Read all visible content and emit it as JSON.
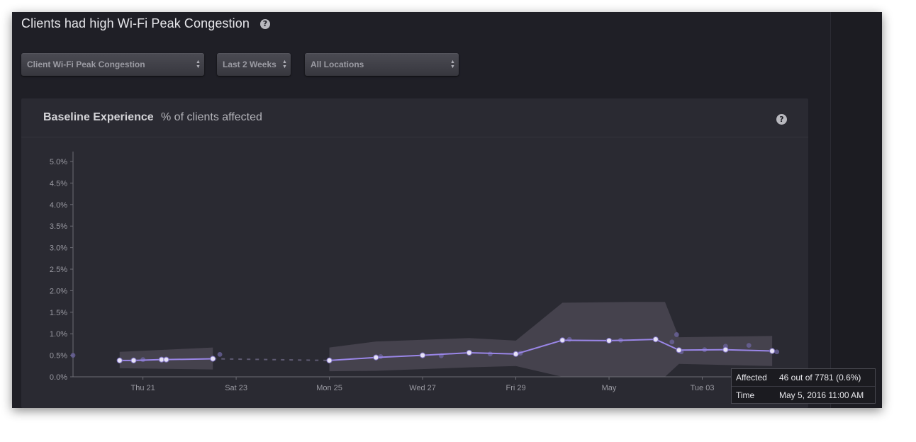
{
  "page": {
    "title": "Clients had high Wi-Fi Peak Congestion",
    "help_icon": "question-circle-icon"
  },
  "filters": {
    "metric": "Client Wi-Fi Peak Congestion",
    "range": "Last 2 Weeks",
    "location": "All Locations"
  },
  "panel": {
    "title": "Baseline Experience",
    "subtitle": "% of clients affected"
  },
  "tooltip": {
    "affected_label": "Affected",
    "affected_value": "46 out of 7781 (0.6%)",
    "time_label": "Time",
    "time_value": "May 5, 2016 11:00 AM"
  },
  "colors": {
    "line": "#9a86e8",
    "band": "#4a4652",
    "point_white": "#e6e2f6",
    "point_dim": "#6d66a0"
  },
  "chart_data": {
    "type": "line",
    "title": "Baseline Experience",
    "subtitle": "% of clients affected",
    "ylim": [
      0,
      5.0
    ],
    "y_ticks": [
      "0.0%",
      "0.5%",
      "1.0%",
      "1.5%",
      "2.0%",
      "2.5%",
      "3.0%",
      "3.5%",
      "4.0%",
      "4.5%",
      "5.0%"
    ],
    "x_range": [
      19.5,
      35.0
    ],
    "x_ticks": [
      {
        "label": "Thu 21",
        "x": 21
      },
      {
        "label": "Sat 23",
        "x": 23
      },
      {
        "label": "Mon 25",
        "x": 25
      },
      {
        "label": "Wed 27",
        "x": 27
      },
      {
        "label": "Fri 29",
        "x": 29
      },
      {
        "label": "May",
        "x": 31
      },
      {
        "label": "Tue 03",
        "x": 33
      }
    ],
    "series": [
      {
        "values": [
          {
            "x": 20.5,
            "y": 0.38
          },
          {
            "x": 20.8,
            "y": 0.38
          },
          {
            "x": 21.4,
            "y": 0.4
          },
          {
            "x": 21.5,
            "y": 0.4
          },
          {
            "x": 22.5,
            "y": 0.42
          },
          {
            "x": 25.0,
            "y": 0.38
          },
          {
            "x": 26.0,
            "y": 0.45
          },
          {
            "x": 27.0,
            "y": 0.5
          },
          {
            "x": 28.0,
            "y": 0.56
          },
          {
            "x": 29.0,
            "y": 0.53
          },
          {
            "x": 30.0,
            "y": 0.85
          },
          {
            "x": 31.0,
            "y": 0.84
          },
          {
            "x": 32.0,
            "y": 0.87
          },
          {
            "x": 32.5,
            "y": 0.62
          },
          {
            "x": 33.5,
            "y": 0.63
          },
          {
            "x": 34.5,
            "y": 0.6
          }
        ],
        "gap": [
          22.5,
          25.0
        ]
      }
    ],
    "band": [
      {
        "x": 20.5,
        "lo": 0.2,
        "hi": 0.58
      },
      {
        "x": 22.5,
        "lo": 0.17,
        "hi": 0.68
      },
      {
        "x": 25.0,
        "lo": 0.13,
        "hi": 0.68
      },
      {
        "x": 26.0,
        "lo": 0.14,
        "hi": 0.82
      },
      {
        "x": 28.0,
        "lo": 0.22,
        "hi": 0.9
      },
      {
        "x": 29.0,
        "lo": 0.25,
        "hi": 0.84
      },
      {
        "x": 30.0,
        "lo": 0.0,
        "hi": 1.72
      },
      {
        "x": 31.5,
        "lo": 0.0,
        "hi": 1.74
      },
      {
        "x": 32.2,
        "lo": 0.0,
        "hi": 1.74
      },
      {
        "x": 32.5,
        "lo": 0.3,
        "hi": 0.92
      },
      {
        "x": 34.5,
        "lo": 0.25,
        "hi": 0.95
      }
    ],
    "scatter": [
      {
        "x": 19.5,
        "y": 0.5
      },
      {
        "x": 21.0,
        "y": 0.4
      },
      {
        "x": 22.65,
        "y": 0.52
      },
      {
        "x": 26.1,
        "y": 0.47
      },
      {
        "x": 27.4,
        "y": 0.49
      },
      {
        "x": 28.45,
        "y": 0.53
      },
      {
        "x": 29.1,
        "y": 0.55
      },
      {
        "x": 30.15,
        "y": 0.87
      },
      {
        "x": 31.25,
        "y": 0.85
      },
      {
        "x": 32.35,
        "y": 0.81
      },
      {
        "x": 32.45,
        "y": 0.98
      },
      {
        "x": 32.55,
        "y": 0.58
      },
      {
        "x": 33.05,
        "y": 0.63
      },
      {
        "x": 33.5,
        "y": 0.71
      },
      {
        "x": 34.0,
        "y": 0.73
      },
      {
        "x": 34.6,
        "y": 0.58
      }
    ]
  }
}
